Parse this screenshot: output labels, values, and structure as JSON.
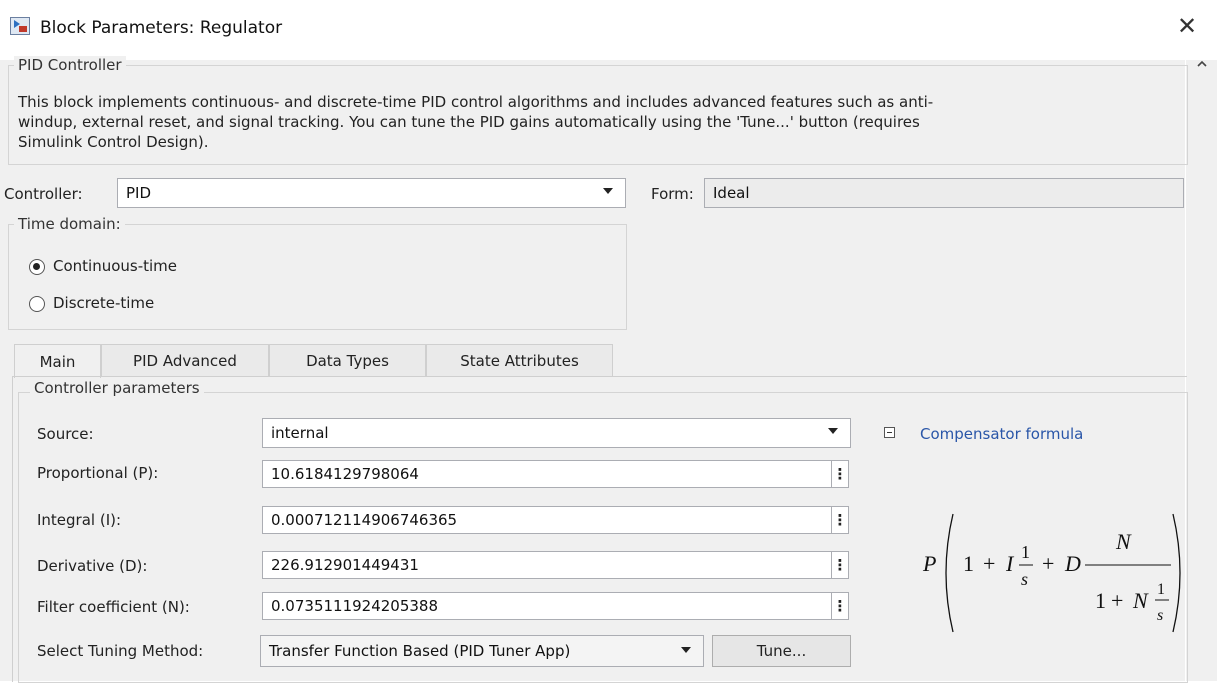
{
  "window": {
    "title": "Block Parameters: Regulator",
    "close_icon": "close-icon",
    "app_icon": "simulink-block-icon"
  },
  "pid_group": {
    "legend": "PID Controller",
    "description_line1": "This block implements continuous- and discrete-time PID control algorithms and includes advanced features such as anti-",
    "description_line2": "windup, external reset, and signal tracking. You can tune the PID gains automatically using the 'Tune...' button (requires",
    "description_line3": "Simulink Control Design)."
  },
  "controller": {
    "label": "Controller:",
    "value": "PID",
    "form_label": "Form:",
    "form_value": "Ideal"
  },
  "time_domain": {
    "legend": "Time domain:",
    "options": [
      {
        "label": "Continuous-time",
        "selected": true
      },
      {
        "label": "Discrete-time",
        "selected": false
      }
    ]
  },
  "tabs": [
    {
      "label": "Main",
      "active": true
    },
    {
      "label": "PID Advanced",
      "active": false
    },
    {
      "label": "Data Types",
      "active": false
    },
    {
      "label": "State Attributes",
      "active": false
    }
  ],
  "params": {
    "legend": "Controller parameters",
    "source_label": "Source:",
    "source_value": "internal",
    "p_label": "Proportional (P):",
    "p_value": "10.6184129798064",
    "i_label": "Integral (I):",
    "i_value": "0.000712114906746365",
    "d_label": "Derivative (D):",
    "d_value": "226.912901449431",
    "n_label": "Filter coefficient (N):",
    "n_value": "0.0735111924205388",
    "tuning_label": "Select Tuning Method:",
    "tuning_value": "Transfer Function Based (PID Tuner App)",
    "tune_button": "Tune...",
    "dots": "⋮"
  },
  "formula": {
    "link": "Compensator formula",
    "P": "P",
    "one": "1",
    "plus": "+",
    "I": "I",
    "D": "D",
    "N": "N",
    "s": "s"
  }
}
